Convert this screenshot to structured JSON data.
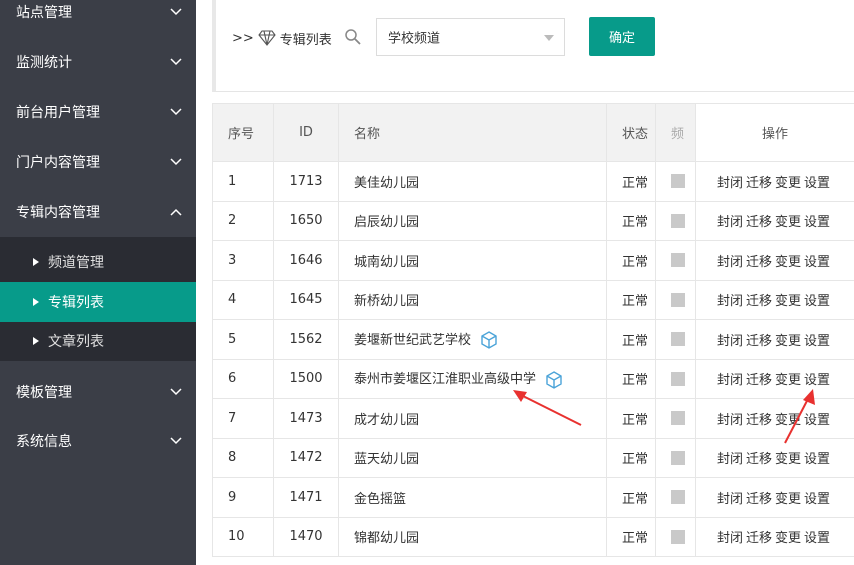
{
  "sidebar": {
    "menus": [
      {
        "label": "站点管理",
        "expanded": false
      },
      {
        "label": "监测统计",
        "expanded": false
      },
      {
        "label": "前台用户管理",
        "expanded": false
      },
      {
        "label": "门户内容管理",
        "expanded": false
      },
      {
        "label": "专辑内容管理",
        "expanded": true
      },
      {
        "label": "模板管理",
        "expanded": false
      },
      {
        "label": "系统信息",
        "expanded": false
      }
    ],
    "submenu": [
      {
        "label": "频道管理",
        "active": false
      },
      {
        "label": "专辑列表",
        "active": true
      },
      {
        "label": "文章列表",
        "active": false
      }
    ]
  },
  "toolbar": {
    "crumb_prefix": ">>",
    "crumb_label": "专辑列表",
    "channel_select_value": "学校频道",
    "confirm_label": "确定"
  },
  "table": {
    "headers": {
      "index": "序号",
      "id": "ID",
      "name": "名称",
      "status": "状态",
      "hidden": "频",
      "ops": "操作"
    },
    "ops_labels": [
      "封闭",
      "迁移",
      "变更",
      "设置"
    ],
    "rows": [
      {
        "index": "1",
        "id": "1713",
        "name": "美佳幼儿园",
        "status": "正常",
        "has_icon": false
      },
      {
        "index": "2",
        "id": "1650",
        "name": "启辰幼儿园",
        "status": "正常",
        "has_icon": false
      },
      {
        "index": "3",
        "id": "1646",
        "name": "城南幼儿园",
        "status": "正常",
        "has_icon": false
      },
      {
        "index": "4",
        "id": "1645",
        "name": "新桥幼儿园",
        "status": "正常",
        "has_icon": false
      },
      {
        "index": "5",
        "id": "1562",
        "name": "姜堰新世纪武艺学校",
        "status": "正常",
        "has_icon": true
      },
      {
        "index": "6",
        "id": "1500",
        "name": "泰州市姜堰区江淮职业高级中学",
        "status": "正常",
        "has_icon": true
      },
      {
        "index": "7",
        "id": "1473",
        "name": "成才幼儿园",
        "status": "正常",
        "has_icon": false
      },
      {
        "index": "8",
        "id": "1472",
        "name": "蓝天幼儿园",
        "status": "正常",
        "has_icon": false
      },
      {
        "index": "9",
        "id": "1471",
        "name": "金色摇篮",
        "status": "正常",
        "has_icon": false
      },
      {
        "index": "10",
        "id": "1470",
        "name": "锦都幼儿园",
        "status": "正常",
        "has_icon": false
      }
    ]
  },
  "colors": {
    "sidebar_bg": "#3b3e47",
    "submenu_bg": "#2a2c33",
    "accent": "#079b8a",
    "annotation_arrow": "#e8312f"
  },
  "icons": {
    "menu_chevron": "chevron-down-icon",
    "expanded_chevron": "chevron-up-icon",
    "album": "diamond-icon",
    "search": "search-icon",
    "row_badge": "cube-icon"
  }
}
